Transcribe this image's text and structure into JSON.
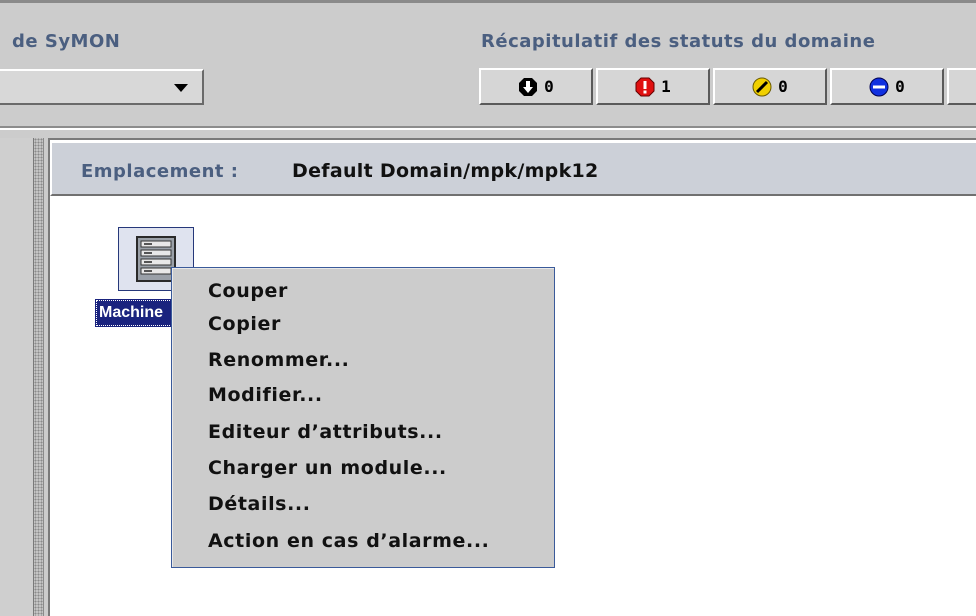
{
  "header": {
    "domain_title": "de SyMON",
    "status_summary_title": "Récapitulatif des statuts du domaine"
  },
  "domain_selector": {
    "value": ""
  },
  "status_summary": [
    {
      "name": "down",
      "icon": "down-arrow-icon",
      "color": "#000000",
      "count": "0"
    },
    {
      "name": "critical",
      "icon": "critical-alarm-icon",
      "color": "#e01010",
      "count": "1"
    },
    {
      "name": "warning",
      "icon": "warning-alarm-icon",
      "color": "#f0d000",
      "count": "0"
    },
    {
      "name": "info",
      "icon": "info-alarm-icon",
      "color": "#1030e0",
      "count": "0"
    }
  ],
  "location": {
    "label": "Emplacement :",
    "path": "Default Domain/mpk/mpk12"
  },
  "host": {
    "label": "Machine",
    "icon": "server-host-icon"
  },
  "context_menu": {
    "items": [
      "Couper",
      "Copier",
      "Renommer...",
      "Modifier...",
      "Editeur d’attributs...",
      "Charger un module...",
      "Détails...",
      "Action en cas d’alarme..."
    ]
  },
  "colors": {
    "title_blue": "#4b5f80",
    "selection_navy": "#1a237e",
    "panel_gray": "#cccccc",
    "menu_border": "#3a5a9a"
  }
}
